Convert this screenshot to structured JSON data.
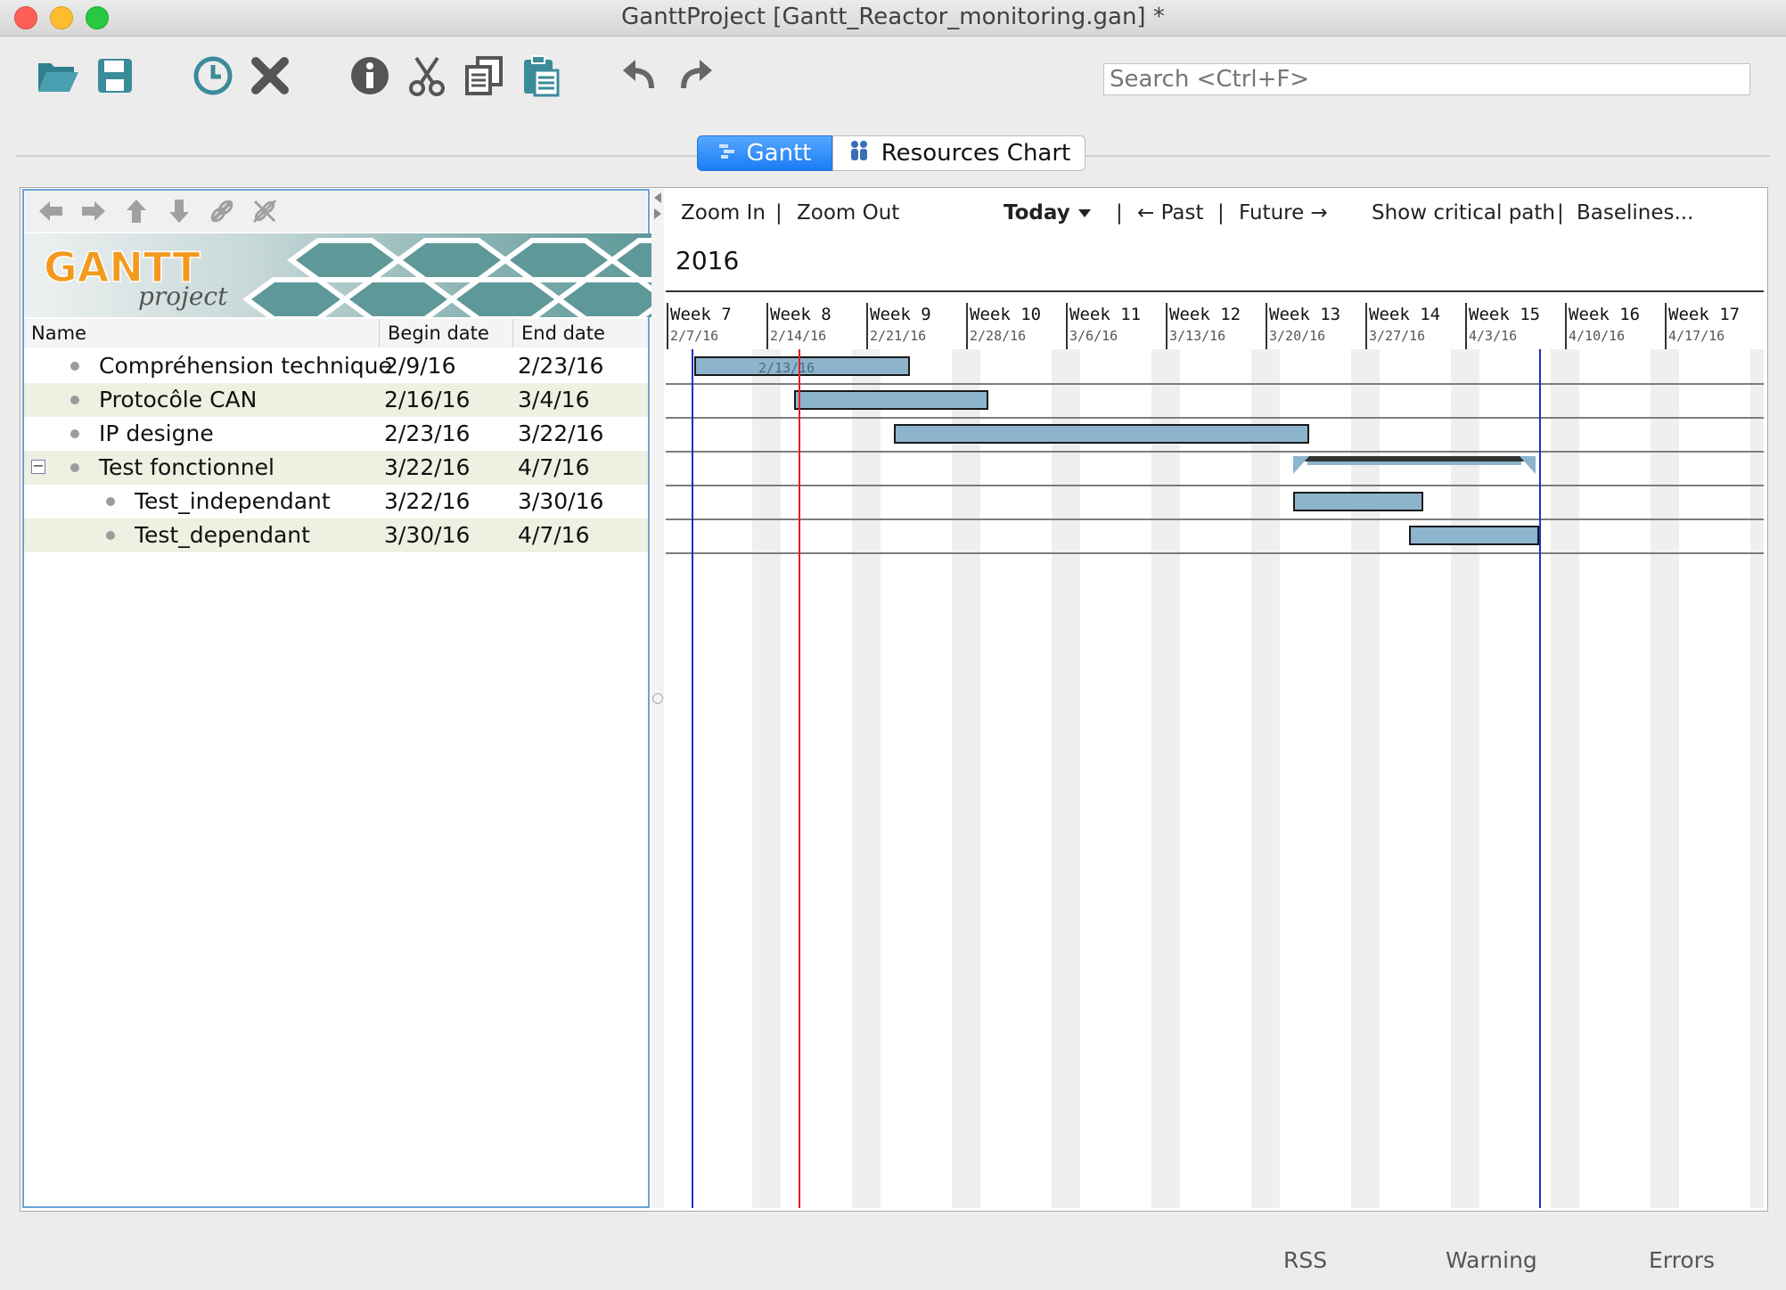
{
  "window": {
    "title": "GanttProject [Gantt_Reactor_monitoring.gan] *"
  },
  "toolbar": {
    "search_placeholder": "Search <Ctrl+F>"
  },
  "tabs": {
    "gantt": "Gantt",
    "resources": "Resources Chart"
  },
  "task_table": {
    "columns": [
      "Name",
      "Begin date",
      "End date"
    ],
    "rows": [
      {
        "name": "Compréhension technique",
        "begin": "2/9/16",
        "end": "2/23/16"
      },
      {
        "name": "Protocôle CAN",
        "begin": "2/16/16",
        "end": "3/4/16"
      },
      {
        "name": "IP designe",
        "begin": "2/23/16",
        "end": "3/22/16"
      },
      {
        "name": "Test fonctionnel",
        "begin": "3/22/16",
        "end": "4/7/16"
      },
      {
        "name": "Test_independant",
        "begin": "3/22/16",
        "end": "3/30/16"
      },
      {
        "name": "Test_dependant",
        "begin": "3/30/16",
        "end": "4/7/16"
      }
    ],
    "collapse_glyph": "−"
  },
  "chart_toolbar": {
    "zoom_in": "Zoom In",
    "zoom_out": "Zoom Out",
    "today": "Today",
    "past": "← Past",
    "future": "Future →",
    "critical_path": "Show critical path",
    "baselines": "Baselines...",
    "separator": "|"
  },
  "timeline": {
    "year": "2016",
    "weeks": [
      {
        "label": "Week 7",
        "date": "2/7/16"
      },
      {
        "label": "Week 8",
        "date": "2/14/16"
      },
      {
        "label": "Week 9",
        "date": "2/21/16"
      },
      {
        "label": "Week 10",
        "date": "2/28/16"
      },
      {
        "label": "Week 11",
        "date": "3/6/16"
      },
      {
        "label": "Week 12",
        "date": "3/13/16"
      },
      {
        "label": "Week 13",
        "date": "3/20/16"
      },
      {
        "label": "Week 14",
        "date": "3/27/16"
      },
      {
        "label": "Week 15",
        "date": "4/3/16"
      },
      {
        "label": "Week 16",
        "date": "4/10/16"
      },
      {
        "label": "Week 17",
        "date": "4/17/16"
      }
    ],
    "today_marker_label": "2/13/16"
  },
  "colors": {
    "bar_fill": "#8cb4cc",
    "today_line": "#e02020",
    "project_bounds_line": "#1f2fc8",
    "row_alt": "#efefe2",
    "tab_active": "#1a7cf5"
  },
  "status_bar": {
    "rss": "RSS",
    "warning": "Warning",
    "errors": "Errors"
  },
  "logo": {
    "text_gantt": "GANTT",
    "text_project": "project"
  }
}
